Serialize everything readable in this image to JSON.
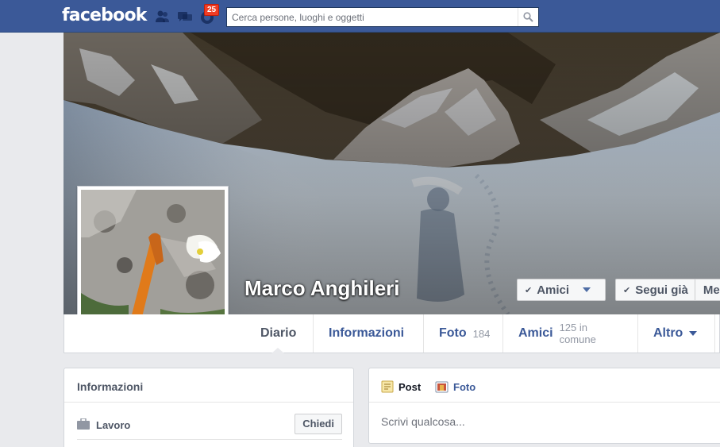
{
  "header": {
    "logo": "facebook",
    "notification_count": "25",
    "search_placeholder": "Cerca persone, luoghi e oggetti",
    "icons": [
      "friend-requests-icon",
      "messages-icon",
      "notifications-icon",
      "search-icon"
    ]
  },
  "profile": {
    "name": "Marco Anghileri",
    "cover_buttons": {
      "friends": "Amici",
      "following": "Segui già",
      "message_partial": "Me"
    }
  },
  "timeline_nav": {
    "tabs": [
      {
        "label": "Diario",
        "count": ""
      },
      {
        "label": "Informazioni",
        "count": ""
      },
      {
        "label": "Foto",
        "count": "184"
      },
      {
        "label": "Amici",
        "count": "125 in comune"
      },
      {
        "label": "Altro",
        "count": ""
      }
    ],
    "active": "Diario"
  },
  "info_card": {
    "title": "Informazioni",
    "work_label": "Lavoro",
    "ask_button": "Chiedi"
  },
  "composer": {
    "post_tab": "Post",
    "photo_tab": "Foto",
    "placeholder": "Scrivi qualcosa..."
  },
  "colors": {
    "topbar": "#3b5998",
    "link": "#3b5998",
    "badge": "#f03d25",
    "page_bg": "#e9eaed"
  }
}
